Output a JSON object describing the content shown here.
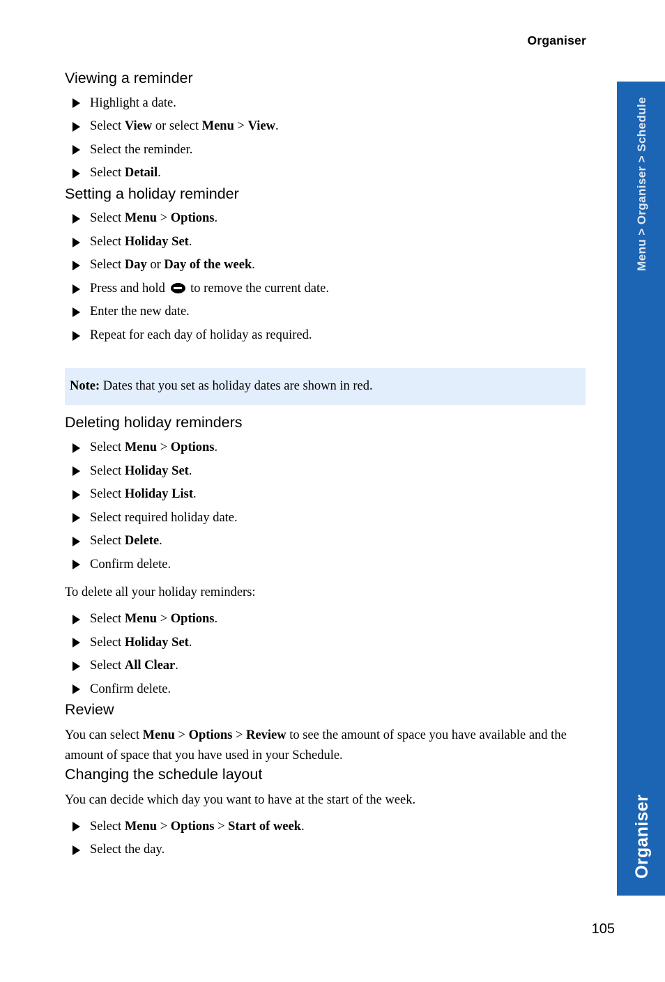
{
  "header": {
    "title": "Organiser"
  },
  "sidebar": {
    "breadcrumb": "Menu > Organiser > Schedule",
    "category": "Organiser",
    "color": "#1c65b5"
  },
  "footer": {
    "page_number": "105"
  },
  "note": {
    "label": "Note:",
    "text": " Dates that you set as holiday dates are shown in red.",
    "background_color": "#e3eefc"
  },
  "sections": {
    "viewing_reminder": {
      "heading": "Viewing a reminder",
      "steps": [
        {
          "id": "highlight-date",
          "parts": [
            {
              "t": "Highlight a date."
            }
          ]
        },
        {
          "id": "select-view",
          "parts": [
            {
              "t": "Select "
            },
            {
              "t": "View",
              "b": true
            },
            {
              "t": " or select "
            },
            {
              "t": "Menu",
              "b": true
            },
            {
              "t": " > "
            },
            {
              "t": "View",
              "b": true
            },
            {
              "t": "."
            }
          ]
        },
        {
          "id": "select-reminder",
          "parts": [
            {
              "t": "Select the reminder."
            }
          ]
        },
        {
          "id": "select-detail",
          "parts": [
            {
              "t": "Select "
            },
            {
              "t": "Detail",
              "b": true
            },
            {
              "t": "."
            }
          ]
        }
      ]
    },
    "setting_holiday": {
      "heading": "Setting a holiday reminder",
      "steps": [
        {
          "id": "menu-options",
          "parts": [
            {
              "t": "Select "
            },
            {
              "t": "Menu",
              "b": true
            },
            {
              "t": " > "
            },
            {
              "t": "Options",
              "b": true
            },
            {
              "t": "."
            }
          ]
        },
        {
          "id": "holiday-set",
          "parts": [
            {
              "t": "Select "
            },
            {
              "t": "Holiday Set",
              "b": true
            },
            {
              "t": "."
            }
          ]
        },
        {
          "id": "day-or-day-of-week",
          "parts": [
            {
              "t": "Select "
            },
            {
              "t": "Day",
              "b": true
            },
            {
              "t": " or "
            },
            {
              "t": "Day of the week",
              "b": true
            },
            {
              "t": "."
            }
          ]
        },
        {
          "id": "press-hold-clear",
          "parts": [
            {
              "t": "Press and hold "
            },
            {
              "icon": "clear-key-icon"
            },
            {
              "t": " to remove the current date."
            }
          ]
        },
        {
          "id": "enter-new-date",
          "parts": [
            {
              "t": "Enter the new date."
            }
          ]
        },
        {
          "id": "repeat-each-day",
          "parts": [
            {
              "t": "Repeat for each day of holiday as required."
            }
          ]
        }
      ]
    },
    "deleting_holiday": {
      "heading": "Deleting holiday reminders",
      "steps": [
        {
          "id": "menu-options",
          "parts": [
            {
              "t": "Select "
            },
            {
              "t": "Menu",
              "b": true
            },
            {
              "t": " > "
            },
            {
              "t": "Options",
              "b": true
            },
            {
              "t": "."
            }
          ]
        },
        {
          "id": "holiday-set",
          "parts": [
            {
              "t": "Select "
            },
            {
              "t": "Holiday Set",
              "b": true
            },
            {
              "t": "."
            }
          ]
        },
        {
          "id": "holiday-list",
          "parts": [
            {
              "t": "Select "
            },
            {
              "t": "Holiday List",
              "b": true
            },
            {
              "t": "."
            }
          ]
        },
        {
          "id": "select-required-date",
          "parts": [
            {
              "t": "Select required holiday date."
            }
          ]
        },
        {
          "id": "select-delete",
          "parts": [
            {
              "t": "Select "
            },
            {
              "t": "Delete",
              "b": true
            },
            {
              "t": "."
            }
          ]
        },
        {
          "id": "confirm-delete",
          "parts": [
            {
              "t": "Confirm delete."
            }
          ]
        }
      ],
      "intro_all": "To delete all your holiday reminders:",
      "steps_all": [
        {
          "id": "menu-options",
          "parts": [
            {
              "t": "Select "
            },
            {
              "t": "Menu",
              "b": true
            },
            {
              "t": " > "
            },
            {
              "t": "Options",
              "b": true
            },
            {
              "t": "."
            }
          ]
        },
        {
          "id": "holiday-set",
          "parts": [
            {
              "t": "Select "
            },
            {
              "t": "Holiday Set",
              "b": true
            },
            {
              "t": "."
            }
          ]
        },
        {
          "id": "all-clear",
          "parts": [
            {
              "t": "Select "
            },
            {
              "t": "All Clear",
              "b": true
            },
            {
              "t": "."
            }
          ]
        },
        {
          "id": "confirm-delete",
          "parts": [
            {
              "t": "Confirm delete."
            }
          ]
        }
      ]
    },
    "review": {
      "heading": "Review",
      "paragraph_parts": [
        {
          "t": "You can select "
        },
        {
          "t": "Menu",
          "b": true
        },
        {
          "t": " > "
        },
        {
          "t": "Options",
          "b": true
        },
        {
          "t": " > "
        },
        {
          "t": "Review",
          "b": true
        },
        {
          "t": " to see the amount of space you have available and the amount of space that you have used in your Schedule."
        }
      ]
    },
    "schedule_layout": {
      "heading": "Changing the schedule layout",
      "paragraph": "You can decide which day you want to have at the start of the week.",
      "steps": [
        {
          "id": "start-of-week",
          "parts": [
            {
              "t": "Select "
            },
            {
              "t": "Menu",
              "b": true
            },
            {
              "t": " > "
            },
            {
              "t": "Options",
              "b": true
            },
            {
              "t": " > "
            },
            {
              "t": "Start of week",
              "b": true
            },
            {
              "t": "."
            }
          ]
        },
        {
          "id": "select-the-day",
          "parts": [
            {
              "t": "Select the day."
            }
          ]
        }
      ]
    }
  }
}
